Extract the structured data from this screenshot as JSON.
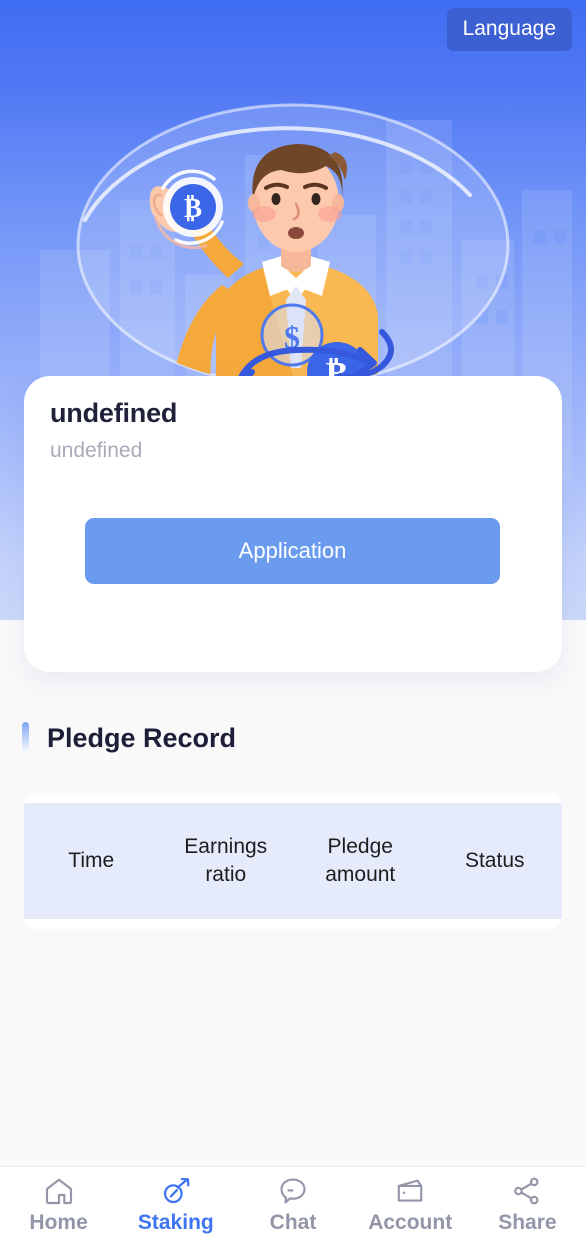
{
  "header": {
    "language_button": "Language"
  },
  "hero": {
    "illustration_name": "man-holding-bitcoin-coin-crypto-exchange-illustration",
    "background_gradient_from": "#3f6df2",
    "background_gradient_to": "#cbd8fa"
  },
  "info_card": {
    "title": "undefined",
    "subtitle": "undefined",
    "action_button": "Application",
    "action_button_color": "#6a9bef"
  },
  "pledge_record": {
    "section_title": "Pledge Record",
    "accent_color": "#7ea5ef",
    "table": {
      "header_background": "#e5ebfa",
      "columns": [
        "Time",
        "Earnings ratio",
        "Pledge amount",
        "Status"
      ],
      "rows": []
    }
  },
  "bottom_nav": {
    "active_color": "#3f75f0",
    "inactive_color": "#9296a8",
    "items": [
      {
        "label": "Home",
        "icon": "home-icon",
        "active": false
      },
      {
        "label": "Staking",
        "icon": "pickaxe-icon",
        "active": true
      },
      {
        "label": "Chat",
        "icon": "chat-bubble-icon",
        "active": false
      },
      {
        "label": "Account",
        "icon": "wallet-icon",
        "active": false
      },
      {
        "label": "Share",
        "icon": "share-nodes-icon",
        "active": false
      }
    ]
  }
}
